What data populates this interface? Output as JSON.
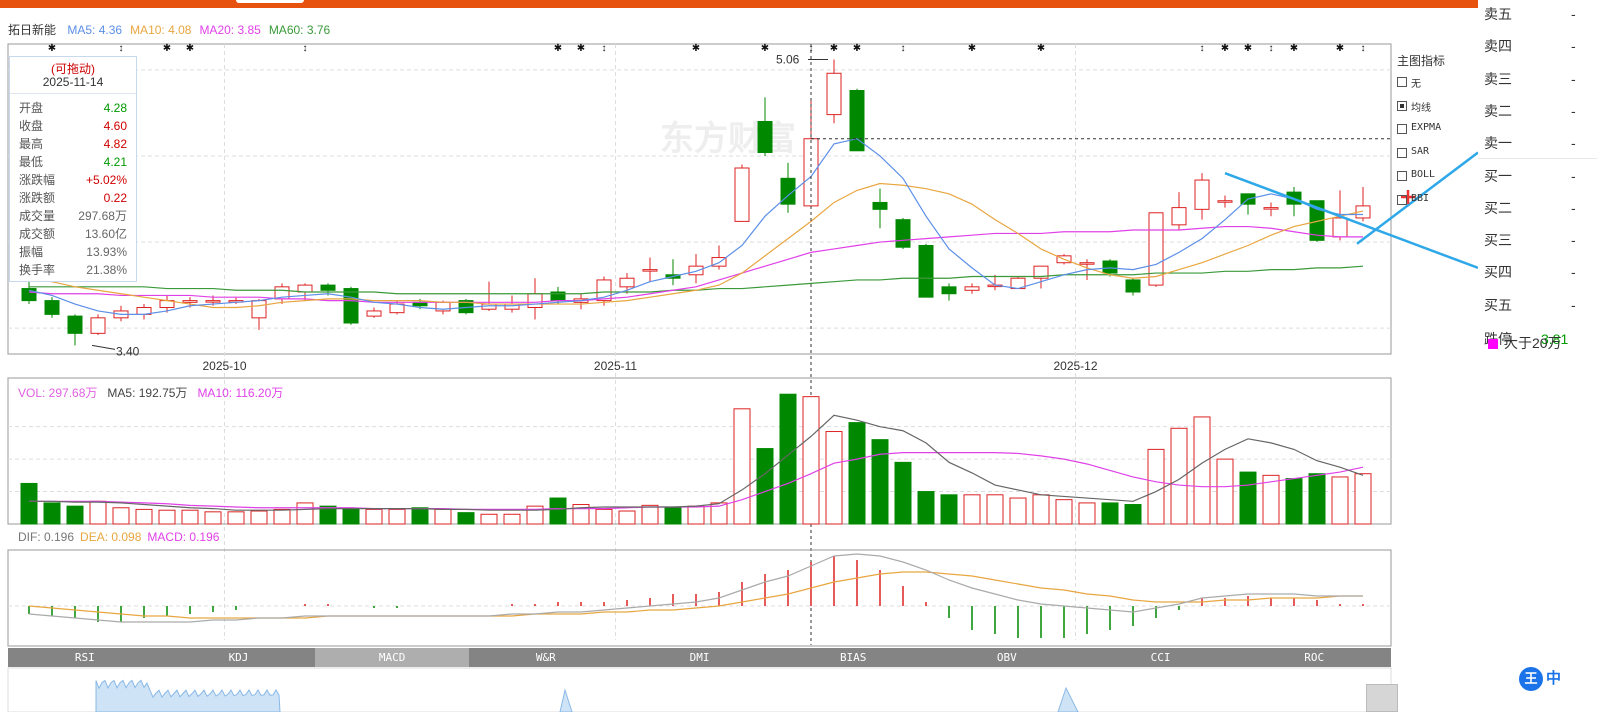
{
  "stock": {
    "name": "拓日新能",
    "ma_legend": [
      {
        "label": "MA5: 4.36",
        "color": "#5b8fe8"
      },
      {
        "label": "MA10: 4.08",
        "color": "#e8a640"
      },
      {
        "label": "MA20: 3.85",
        "color": "#e040e8"
      },
      {
        "label": "MA60: 3.76",
        "color": "#3a9a3a"
      }
    ]
  },
  "tooltip": {
    "header": "(可拖动)",
    "date": "2025-11-14",
    "rows": [
      {
        "label": "开盘",
        "value": "4.28",
        "color": "#009900"
      },
      {
        "label": "收盘",
        "value": "4.60",
        "color": "#d00000"
      },
      {
        "label": "最高",
        "value": "4.82",
        "color": "#d00000"
      },
      {
        "label": "最低",
        "value": "4.21",
        "color": "#009900"
      },
      {
        "label": "涨跌幅",
        "value": "+5.02%",
        "color": "#d00000"
      },
      {
        "label": "涨跌额",
        "value": "0.22",
        "color": "#d00000"
      },
      {
        "label": "成交量",
        "value": "297.68万",
        "color": "#666666"
      },
      {
        "label": "成交额",
        "value": "13.60亿",
        "color": "#666666"
      },
      {
        "label": "振幅",
        "value": "13.93%",
        "color": "#666666"
      },
      {
        "label": "换手率",
        "value": "21.38%",
        "color": "#666666"
      }
    ]
  },
  "indicator_panel": {
    "title": "主图指标",
    "options": [
      {
        "label": "无",
        "checked": false
      },
      {
        "label": "均线",
        "checked": true
      },
      {
        "label": "EXPMA",
        "checked": false
      },
      {
        "label": "SAR",
        "checked": false
      },
      {
        "label": "BOLL",
        "checked": false
      },
      {
        "label": "BBI",
        "checked": false
      }
    ]
  },
  "annotations": {
    "high_label": "5.06",
    "low_label": "3.40",
    "watermark": "东方财富"
  },
  "x_axis_labels": [
    {
      "label": "2025-10",
      "index": 9
    },
    {
      "label": "2025-11",
      "index": 26
    },
    {
      "label": "2025-12",
      "index": 46
    }
  ],
  "volume_legend": [
    {
      "label": "VOL: 297.68万",
      "color": "#e060e0"
    },
    {
      "label": "MA5: 192.75万",
      "color": "#444444"
    },
    {
      "label": "MA10: 116.20万",
      "color": "#e040e8"
    }
  ],
  "macd_legend": [
    {
      "label": "DIF: 0.196",
      "color": "#777777"
    },
    {
      "label": "DEA: 0.098",
      "color": "#e8a640"
    },
    {
      "label": "MACD: 0.196",
      "color": "#e040e8"
    }
  ],
  "indicator_tabs": [
    "RSI",
    "KDJ",
    "MACD",
    "W&R",
    "DMI",
    "BIAS",
    "OBV",
    "CCI",
    "ROC"
  ],
  "active_tab": "MACD",
  "order_book": [
    {
      "label": "卖五",
      "value": "-"
    },
    {
      "label": "卖四",
      "value": "-"
    },
    {
      "label": "卖三",
      "value": "-"
    },
    {
      "label": "卖二",
      "value": "-"
    },
    {
      "label": "卖一",
      "value": "-"
    },
    {
      "label": "买一",
      "value": "-"
    },
    {
      "label": "买二",
      "value": "-"
    },
    {
      "label": "买三",
      "value": "-"
    },
    {
      "label": "买四",
      "value": "-"
    },
    {
      "label": "买五",
      "value": "-"
    }
  ],
  "limit_down": {
    "label": "跌停",
    "value": "3.81"
  },
  "big_order_legend": "大于20万",
  "side_bottom": {
    "badge": "王",
    "text": "中"
  },
  "chart_data": [
    {
      "type": "candlestick",
      "title": "拓日新能",
      "x_labels": [
        "2025-10",
        "2025-11",
        "2025-12"
      ],
      "candles": [
        [
          3.73,
          3.66,
          3.78,
          3.64
        ],
        [
          3.66,
          3.58,
          3.68,
          3.56
        ],
        [
          3.57,
          3.47,
          3.58,
          3.4
        ],
        [
          3.47,
          3.56,
          3.58,
          3.46
        ],
        [
          3.56,
          3.6,
          3.63,
          3.54
        ],
        [
          3.58,
          3.62,
          3.64,
          3.55
        ],
        [
          3.62,
          3.66,
          3.69,
          3.59
        ],
        [
          3.65,
          3.66,
          3.68,
          3.62
        ],
        [
          3.66,
          3.66,
          3.69,
          3.63
        ],
        [
          3.66,
          3.66,
          3.68,
          3.64
        ],
        [
          3.56,
          3.66,
          3.67,
          3.49
        ],
        [
          3.67,
          3.74,
          3.76,
          3.64
        ],
        [
          3.71,
          3.75,
          3.76,
          3.66
        ],
        [
          3.75,
          3.72,
          3.76,
          3.69
        ],
        [
          3.73,
          3.53,
          3.74,
          3.52
        ],
        [
          3.57,
          3.6,
          3.62,
          3.56
        ],
        [
          3.59,
          3.64,
          3.66,
          3.58
        ],
        [
          3.65,
          3.63,
          3.67,
          3.61
        ],
        [
          3.6,
          3.65,
          3.66,
          3.58
        ],
        [
          3.66,
          3.59,
          3.67,
          3.58
        ],
        [
          3.61,
          3.64,
          3.77,
          3.6
        ],
        [
          3.61,
          3.64,
          3.69,
          3.59
        ],
        [
          3.62,
          3.7,
          3.79,
          3.55
        ],
        [
          3.71,
          3.66,
          3.74,
          3.64
        ],
        [
          3.65,
          3.67,
          3.7,
          3.61
        ],
        [
          3.66,
          3.78,
          3.8,
          3.63
        ],
        [
          3.74,
          3.79,
          3.82,
          3.7
        ],
        [
          3.84,
          3.84,
          3.91,
          3.77
        ],
        [
          3.81,
          3.79,
          3.9,
          3.75
        ],
        [
          3.81,
          3.86,
          3.93,
          3.76
        ],
        [
          3.86,
          3.91,
          3.98,
          3.84
        ],
        [
          4.12,
          4.43,
          4.45,
          4.12
        ],
        [
          4.7,
          4.52,
          4.84,
          4.5
        ],
        [
          4.37,
          4.22,
          4.46,
          4.17
        ],
        [
          4.21,
          4.6,
          4.82,
          4.21
        ],
        [
          4.74,
          4.98,
          5.06,
          4.69
        ],
        [
          4.88,
          4.53,
          4.89,
          4.53
        ],
        [
          4.23,
          4.19,
          4.31,
          4.08
        ],
        [
          4.13,
          3.97,
          4.14,
          3.96
        ],
        [
          3.98,
          3.68,
          3.99,
          3.68
        ],
        [
          3.74,
          3.7,
          3.76,
          3.66
        ],
        [
          3.72,
          3.74,
          3.76,
          3.7
        ],
        [
          3.75,
          3.75,
          3.81,
          3.72
        ],
        [
          3.73,
          3.79,
          3.8,
          3.73
        ],
        [
          3.79,
          3.86,
          3.86,
          3.73
        ],
        [
          3.88,
          3.92,
          3.93,
          3.87
        ],
        [
          3.88,
          3.88,
          3.9,
          3.78
        ],
        [
          3.89,
          3.82,
          3.9,
          3.8
        ],
        [
          3.78,
          3.71,
          3.79,
          3.69
        ],
        [
          3.75,
          4.17,
          4.17,
          3.74
        ],
        [
          4.1,
          4.2,
          4.29,
          4.07
        ],
        [
          4.19,
          4.36,
          4.4,
          4.13
        ],
        [
          4.24,
          4.24,
          4.27,
          4.2
        ],
        [
          4.28,
          4.22,
          4.28,
          4.16
        ],
        [
          4.2,
          4.2,
          4.23,
          4.15
        ],
        [
          4.29,
          4.22,
          4.32,
          4.15
        ],
        [
          4.24,
          4.01,
          4.24,
          4.0
        ],
        [
          4.03,
          4.14,
          4.3,
          4.01
        ],
        [
          4.14,
          4.21,
          4.32,
          4.12
        ]
      ],
      "ma5": [
        3.72,
        3.69,
        3.64,
        3.6,
        3.58,
        3.58,
        3.6,
        3.63,
        3.64,
        3.65,
        3.66,
        3.68,
        3.69,
        3.7,
        3.68,
        3.65,
        3.64,
        3.62,
        3.61,
        3.62,
        3.63,
        3.63,
        3.64,
        3.65,
        3.66,
        3.68,
        3.72,
        3.77,
        3.8,
        3.83,
        3.88,
        3.98,
        4.15,
        4.27,
        4.38,
        4.57,
        4.6,
        4.5,
        4.37,
        4.15,
        3.96,
        3.85,
        3.75,
        3.73,
        3.77,
        3.81,
        3.84,
        3.85,
        3.84,
        3.87,
        3.94,
        4.02,
        4.13,
        4.25,
        4.28,
        4.25,
        4.19,
        4.16,
        4.16
      ],
      "ma10": [
        3.78,
        3.77,
        3.74,
        3.72,
        3.7,
        3.68,
        3.66,
        3.64,
        3.62,
        3.62,
        3.63,
        3.65,
        3.66,
        3.67,
        3.67,
        3.66,
        3.66,
        3.66,
        3.65,
        3.65,
        3.64,
        3.64,
        3.64,
        3.64,
        3.64,
        3.65,
        3.66,
        3.68,
        3.7,
        3.72,
        3.75,
        3.82,
        3.92,
        4.02,
        4.12,
        4.23,
        4.3,
        4.34,
        4.33,
        4.31,
        4.28,
        4.22,
        4.13,
        4.05,
        3.96,
        3.9,
        3.85,
        3.81,
        3.79,
        3.8,
        3.84,
        3.88,
        3.93,
        3.98,
        4.04,
        4.09,
        4.12,
        4.15,
        4.18
      ],
      "ma20": [
        3.71,
        3.7,
        3.7,
        3.7,
        3.69,
        3.69,
        3.69,
        3.69,
        3.68,
        3.68,
        3.68,
        3.67,
        3.67,
        3.66,
        3.66,
        3.65,
        3.65,
        3.65,
        3.65,
        3.65,
        3.65,
        3.65,
        3.65,
        3.66,
        3.66,
        3.67,
        3.68,
        3.7,
        3.72,
        3.74,
        3.78,
        3.82,
        3.86,
        3.9,
        3.94,
        3.96,
        3.98,
        4.0,
        4.01,
        4.02,
        4.03,
        4.04,
        4.05,
        4.05,
        4.05,
        4.06,
        4.06,
        4.06,
        4.07,
        4.07,
        4.07,
        4.08,
        4.09,
        4.09,
        4.08,
        4.06,
        4.04,
        4.03,
        4.03
      ],
      "ma60": [
        3.74,
        3.74,
        3.74,
        3.74,
        3.74,
        3.74,
        3.73,
        3.73,
        3.73,
        3.72,
        3.72,
        3.72,
        3.71,
        3.71,
        3.71,
        3.71,
        3.7,
        3.7,
        3.7,
        3.7,
        3.7,
        3.7,
        3.7,
        3.7,
        3.7,
        3.71,
        3.71,
        3.71,
        3.72,
        3.72,
        3.73,
        3.73,
        3.74,
        3.75,
        3.76,
        3.77,
        3.78,
        3.78,
        3.79,
        3.79,
        3.79,
        3.8,
        3.8,
        3.8,
        3.8,
        3.81,
        3.81,
        3.81,
        3.81,
        3.82,
        3.82,
        3.82,
        3.83,
        3.83,
        3.84,
        3.84,
        3.85,
        3.85,
        3.86
      ],
      "y_range": [
        3.35,
        5.15
      ]
    },
    {
      "type": "bar",
      "title": "VOL",
      "values": [
        50,
        26,
        22,
        28,
        20,
        18,
        17,
        17,
        15,
        15,
        16,
        18,
        26,
        22,
        18,
        18,
        18,
        20,
        18,
        14,
        12,
        12,
        22,
        32,
        24,
        18,
        16,
        23,
        20,
        22,
        26,
        142,
        93,
        160,
        157,
        114,
        125,
        104,
        76,
        40,
        36,
        36,
        36,
        32,
        36,
        30,
        26,
        26,
        24,
        92,
        118,
        132,
        80,
        64,
        60,
        56,
        62,
        58,
        62
      ],
      "ma5": [
        28,
        28,
        27,
        27,
        26,
        24,
        22,
        20,
        19,
        17,
        17,
        17,
        18,
        19,
        19,
        19,
        19,
        19,
        18,
        18,
        17,
        17,
        17,
        18,
        20,
        21,
        21,
        21,
        21,
        22,
        25,
        42,
        62,
        85,
        108,
        134,
        128,
        120,
        115,
        100,
        76,
        63,
        48,
        42,
        36,
        34,
        32,
        30,
        28,
        40,
        55,
        75,
        92,
        105,
        100,
        92,
        78,
        70,
        60
      ],
      "ma10": [
        28,
        28,
        28,
        28,
        27,
        26,
        25,
        23,
        22,
        21,
        20,
        20,
        20,
        20,
        20,
        19,
        19,
        19,
        19,
        18,
        18,
        18,
        18,
        19,
        19,
        19,
        20,
        21,
        21,
        21,
        22,
        30,
        40,
        50,
        62,
        75,
        80,
        86,
        88,
        88,
        88,
        88,
        88,
        87,
        84,
        80,
        74,
        66,
        58,
        52,
        48,
        46,
        46,
        48,
        52,
        56,
        60,
        64,
        70
      ]
    },
    {
      "type": "bar",
      "title": "MACD",
      "dif": [
        -0.04,
        -0.05,
        -0.06,
        -0.07,
        -0.08,
        -0.08,
        -0.08,
        -0.08,
        -0.07,
        -0.07,
        -0.06,
        -0.06,
        -0.05,
        -0.05,
        -0.05,
        -0.05,
        -0.05,
        -0.05,
        -0.05,
        -0.05,
        -0.05,
        -0.04,
        -0.04,
        -0.03,
        -0.03,
        -0.02,
        -0.01,
        0.0,
        0.01,
        0.02,
        0.04,
        0.08,
        0.12,
        0.15,
        0.2,
        0.25,
        0.26,
        0.25,
        0.22,
        0.18,
        0.13,
        0.09,
        0.06,
        0.03,
        0.01,
        0.0,
        -0.01,
        -0.02,
        -0.03,
        -0.01,
        0.01,
        0.04,
        0.05,
        0.06,
        0.06,
        0.06,
        0.05,
        0.05,
        0.05
      ],
      "dea": [
        0.0,
        -0.01,
        -0.02,
        -0.03,
        -0.04,
        -0.05,
        -0.05,
        -0.06,
        -0.06,
        -0.06,
        -0.06,
        -0.06,
        -0.06,
        -0.05,
        -0.05,
        -0.05,
        -0.05,
        -0.05,
        -0.05,
        -0.05,
        -0.05,
        -0.05,
        -0.04,
        -0.04,
        -0.04,
        -0.03,
        -0.03,
        -0.02,
        -0.02,
        -0.01,
        0.0,
        0.02,
        0.04,
        0.06,
        0.09,
        0.12,
        0.14,
        0.16,
        0.17,
        0.17,
        0.16,
        0.15,
        0.13,
        0.11,
        0.09,
        0.08,
        0.06,
        0.05,
        0.03,
        0.02,
        0.02,
        0.02,
        0.03,
        0.03,
        0.04,
        0.04,
        0.04,
        0.05,
        0.05
      ],
      "hist": [
        -0.04,
        -0.05,
        -0.06,
        -0.08,
        -0.08,
        -0.06,
        -0.05,
        -0.04,
        -0.03,
        -0.02,
        0.0,
        0.0,
        0.01,
        0.01,
        0.0,
        -0.01,
        -0.01,
        0.0,
        0.0,
        0.0,
        0.0,
        0.01,
        0.01,
        0.02,
        0.02,
        0.02,
        0.03,
        0.04,
        0.06,
        0.06,
        0.07,
        0.12,
        0.16,
        0.18,
        0.22,
        0.25,
        0.23,
        0.18,
        0.1,
        0.02,
        -0.06,
        -0.12,
        -0.14,
        -0.16,
        -0.16,
        -0.16,
        -0.14,
        -0.12,
        -0.1,
        -0.06,
        -0.02,
        0.04,
        0.04,
        0.05,
        0.04,
        0.04,
        0.03,
        0.01,
        0.01
      ]
    }
  ]
}
